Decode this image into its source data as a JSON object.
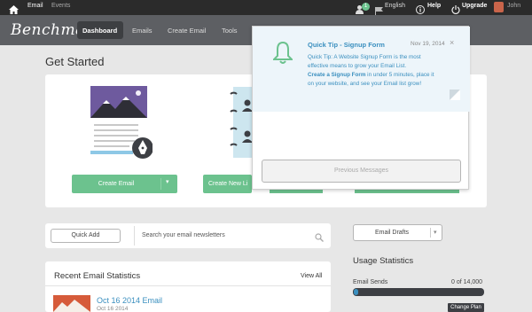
{
  "topbar": {
    "email_label": "Email",
    "events_label": "Events",
    "notification_count": "1",
    "language_label": "English",
    "help_label": "Help",
    "upgrade_label": "Upgrade",
    "user_name": "John"
  },
  "navbar": {
    "logo_text": "Benchmark",
    "items": [
      {
        "label": "Dashboard"
      },
      {
        "label": "Emails"
      },
      {
        "label": "Create Email"
      },
      {
        "label": "Tools"
      }
    ]
  },
  "main": {
    "title": "Get Started",
    "create_email_label": "Create Email",
    "create_list_label": "Create New Li"
  },
  "popup": {
    "title": "Quick Tip - Signup Form",
    "date": "Nov 19, 2014",
    "body_line1": "Quick Tip: A Website Signup Form is the most",
    "body_line2": "effective means to grow your Email List.",
    "link_text": "Create a Signup Form",
    "body_line3": " in under 5 minutes, place it",
    "body_line4": "on your website, and see your Email list grow!",
    "previous_label": "Previous Messages"
  },
  "toolbar": {
    "quick_add_label": "Quick Add",
    "search_placeholder": "Search your email newsletters",
    "email_drafts_label": "Email Drafts"
  },
  "recent": {
    "title": "Recent Email Statistics",
    "view_all_label": "View All",
    "item_title": "Oct 16 2014 Email",
    "item_date": "Oct 16 2014"
  },
  "usage": {
    "title": "Usage Statistics",
    "email_sends_label": "Email Sends",
    "email_sends_value": "0 of 14,000",
    "change_plan_label": "Change Plan"
  }
}
